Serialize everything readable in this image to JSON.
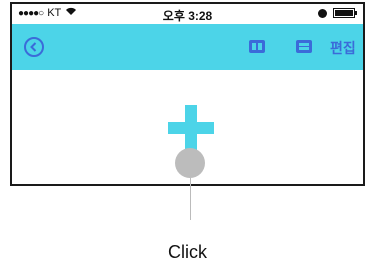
{
  "status_bar": {
    "signal": "●●●●○",
    "carrier": "KT",
    "wifi_icon": "wifi-icon",
    "time": "오후 3:28",
    "alarm_icon": "alarm-icon",
    "battery_icon": "battery-icon"
  },
  "nav_bar": {
    "background": "#4cd4e8",
    "accent": "#3b6bd9",
    "back_icon": "back-arrow-circle-icon",
    "layout_icons": [
      "two-column-layout-icon",
      "two-row-layout-icon"
    ],
    "edit_label": "편집"
  },
  "content": {
    "add_icon": "plus-icon"
  },
  "annotation": {
    "label": "Click"
  }
}
